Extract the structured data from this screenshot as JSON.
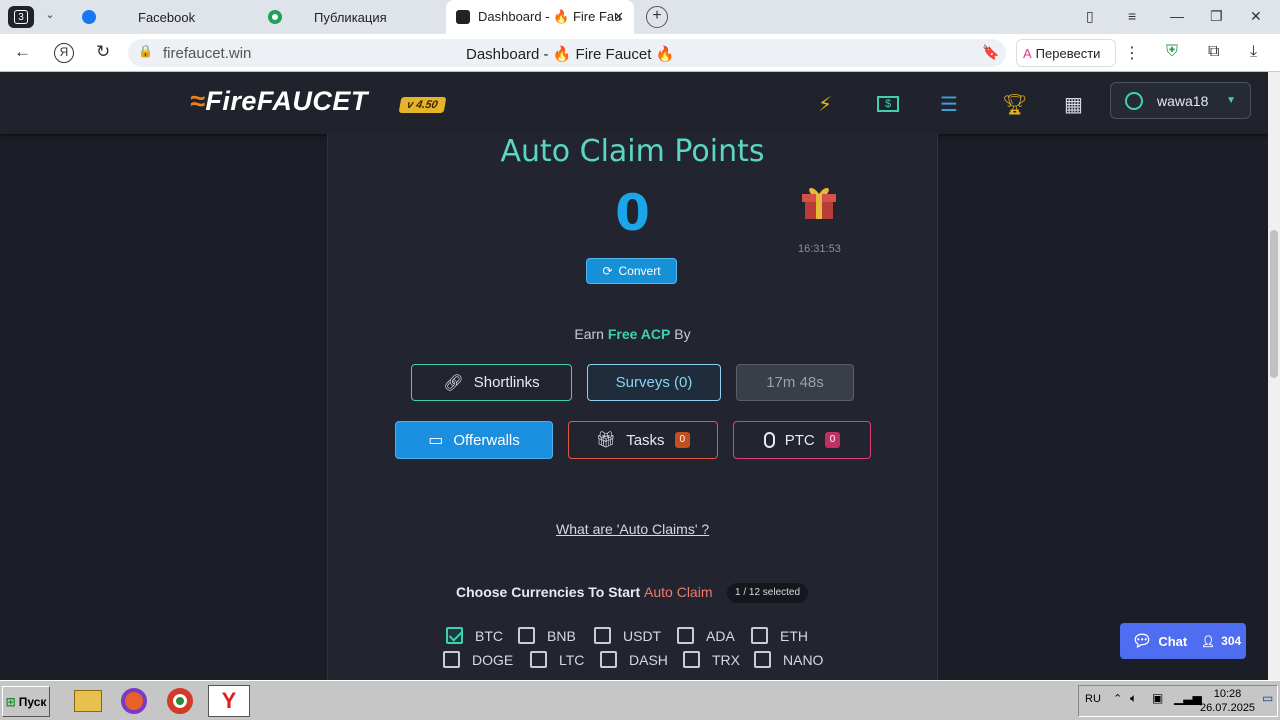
{
  "browser": {
    "tab_count": "3",
    "tabs": [
      {
        "label": "Facebook"
      },
      {
        "label": "Публикация"
      },
      {
        "label": "Dashboard - 🔥 Fire Fau"
      }
    ],
    "url": "firefaucet.win",
    "page_title": "Dashboard - 🔥 Fire Faucet 🔥",
    "translate_label": "Перевести"
  },
  "site": {
    "logo_fire": "Fire",
    "logo_faucet": "FAUCET",
    "version": "v 4.50",
    "username": "wawa18",
    "nav_icons": [
      "bolt-icon",
      "money-icon",
      "list-icon",
      "trophy-icon",
      "calendar-icon"
    ]
  },
  "acp": {
    "title": "Auto Claim Points",
    "value": "0",
    "time": "16:31:53",
    "convert_label": "Convert"
  },
  "earn": {
    "prefix": "Earn",
    "highlight": "Free ACP",
    "suffix": "By"
  },
  "buttons": {
    "shortlinks": "Shortlinks",
    "surveys": "Surveys (0)",
    "timer": "17m 48s",
    "offerwalls": "Offerwalls",
    "tasks": "Tasks",
    "tasks_count": "0",
    "ptc": "PTC",
    "ptc_count": "0"
  },
  "auto_claim_link": "What are 'Auto Claims' ?",
  "choose": {
    "prefix": "Choose Currencies To Start",
    "accent": "Auto Claim",
    "selected": "1 / 12 selected"
  },
  "currencies": [
    {
      "name": "BTC",
      "checked": true
    },
    {
      "name": "BNB",
      "checked": false
    },
    {
      "name": "USDT",
      "checked": false
    },
    {
      "name": "ADA",
      "checked": false
    },
    {
      "name": "ETH",
      "checked": false
    },
    {
      "name": "DOGE",
      "checked": false
    },
    {
      "name": "LTC",
      "checked": false
    },
    {
      "name": "DASH",
      "checked": false
    },
    {
      "name": "TRX",
      "checked": false
    },
    {
      "name": "NANO",
      "checked": false
    }
  ],
  "chat": {
    "label": "Chat",
    "count": "304"
  },
  "taskbar": {
    "start_label": "Пуск",
    "lang": "RU",
    "time": "10:28",
    "date": "26.07.2025"
  }
}
